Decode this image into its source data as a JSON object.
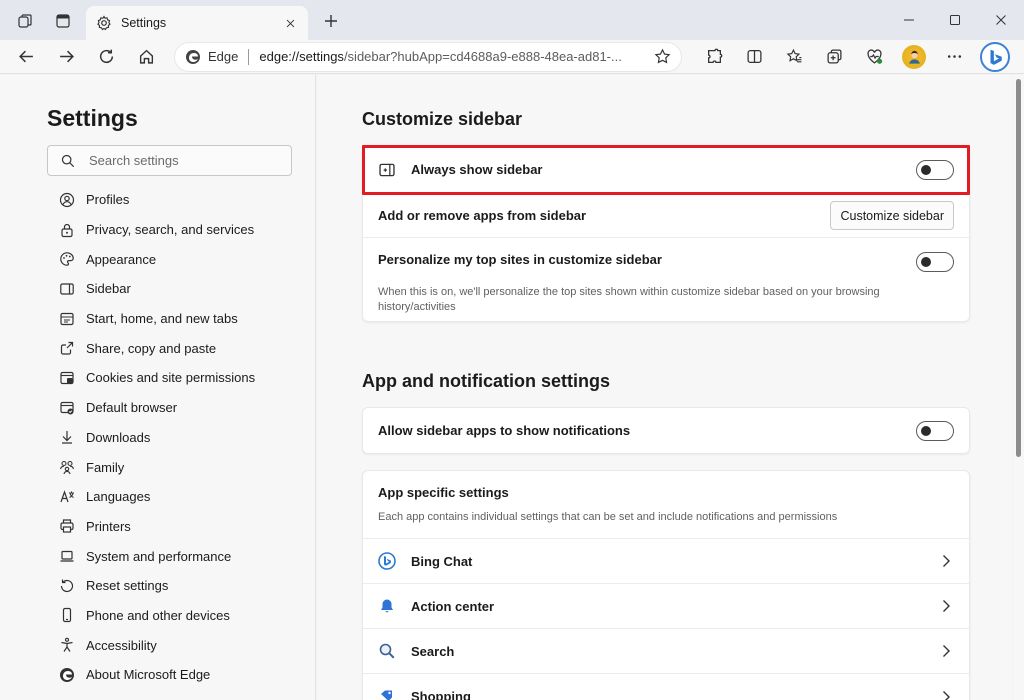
{
  "tab": {
    "title": "Settings"
  },
  "address": {
    "site": "Edge",
    "url_host": "edge://settings",
    "url_path": "/sidebar?hubApp=cd4688a9-e888-48ea-ad81-..."
  },
  "settings": {
    "title": "Settings",
    "search_placeholder": "Search settings",
    "nav": [
      {
        "label": "Profiles",
        "icon": "profile-icon"
      },
      {
        "label": "Privacy, search, and services",
        "icon": "lock-icon"
      },
      {
        "label": "Appearance",
        "icon": "palette-icon"
      },
      {
        "label": "Sidebar",
        "icon": "sidebar-icon"
      },
      {
        "label": "Start, home, and new tabs",
        "icon": "home-tabs-icon"
      },
      {
        "label": "Share, copy and paste",
        "icon": "share-icon"
      },
      {
        "label": "Cookies and site permissions",
        "icon": "cookie-icon"
      },
      {
        "label": "Default browser",
        "icon": "default-browser-icon"
      },
      {
        "label": "Downloads",
        "icon": "download-icon"
      },
      {
        "label": "Family",
        "icon": "family-icon"
      },
      {
        "label": "Languages",
        "icon": "language-icon"
      },
      {
        "label": "Printers",
        "icon": "printer-icon"
      },
      {
        "label": "System and performance",
        "icon": "laptop-icon"
      },
      {
        "label": "Reset settings",
        "icon": "reset-icon"
      },
      {
        "label": "Phone and other devices",
        "icon": "phone-icon"
      },
      {
        "label": "Accessibility",
        "icon": "accessibility-icon"
      },
      {
        "label": "About Microsoft Edge",
        "icon": "edge-icon"
      }
    ]
  },
  "customize": {
    "title": "Customize sidebar",
    "always_show": {
      "label": "Always show sidebar",
      "toggle": "off"
    },
    "add_remove": {
      "label": "Add or remove apps from sidebar",
      "button": "Customize sidebar"
    },
    "personalize": {
      "label": "Personalize my top sites in customize sidebar",
      "desc": "When this is on, we'll personalize the top sites shown within customize sidebar based on your browsing history/activities",
      "toggle": "off"
    }
  },
  "notifications": {
    "title": "App and notification settings",
    "allow": {
      "label": "Allow sidebar apps to show notifications",
      "toggle": "off"
    },
    "app_specific": {
      "title": "App specific settings",
      "desc": "Each app contains individual settings that can be set and include notifications and permissions",
      "apps": [
        {
          "label": "Bing Chat",
          "icon": "bing-chat-icon"
        },
        {
          "label": "Action center",
          "icon": "bell-icon"
        },
        {
          "label": "Search",
          "icon": "search-icon"
        },
        {
          "label": "Shopping",
          "icon": "shopping-icon"
        }
      ]
    }
  },
  "colors": {
    "highlight": "#e31b23",
    "accent": "#3b82d6"
  }
}
